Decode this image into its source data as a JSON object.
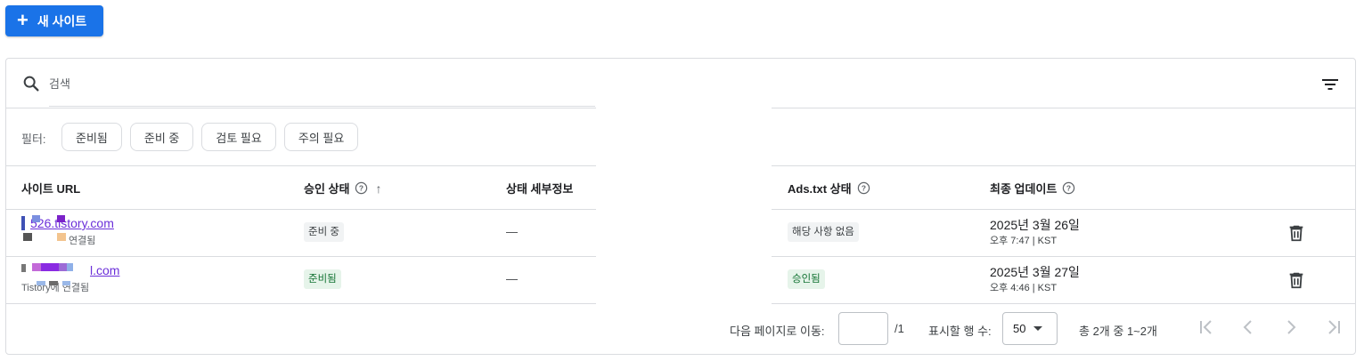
{
  "toolbar": {
    "new_site_label": "새 사이트"
  },
  "search": {
    "placeholder": "검색"
  },
  "filters": {
    "label": "필터:",
    "chips": [
      "준비됨",
      "준비 중",
      "검토 필요",
      "주의 필요"
    ]
  },
  "table": {
    "headers": {
      "site_url": "사이트 URL",
      "approval": "승인 상태",
      "details": "상태 세부정보",
      "ads_txt": "Ads.txt 상태",
      "updated": "최종 업데이트"
    },
    "rows": [
      {
        "site": "526.tistory.com",
        "site_sub": "연결됨",
        "approval": "준비 중",
        "details": "—",
        "ads_txt": "해당 사항 없음",
        "date": "2025년 3월 26일",
        "time": "오후 7:47 | KST"
      },
      {
        "site": "l.com",
        "site_sub": "Tistory에 연결됨",
        "approval": "준비됨",
        "details": "—",
        "ads_txt": "승인됨",
        "date": "2025년 3월 27일",
        "time": "오후 4:46 | KST"
      }
    ]
  },
  "pagination": {
    "goto_label": "다음 페이지로 이동:",
    "total_pages": "/1",
    "rows_label": "표시할 행 수:",
    "rows_value": "50",
    "range_text": "총 2개 중 1~2개"
  },
  "colors": {
    "primary": "#1a73e8",
    "link": "#6b2fd9",
    "approved_bg": "#e6f4ea",
    "approved_text": "#137333",
    "border": "#dadce0"
  }
}
